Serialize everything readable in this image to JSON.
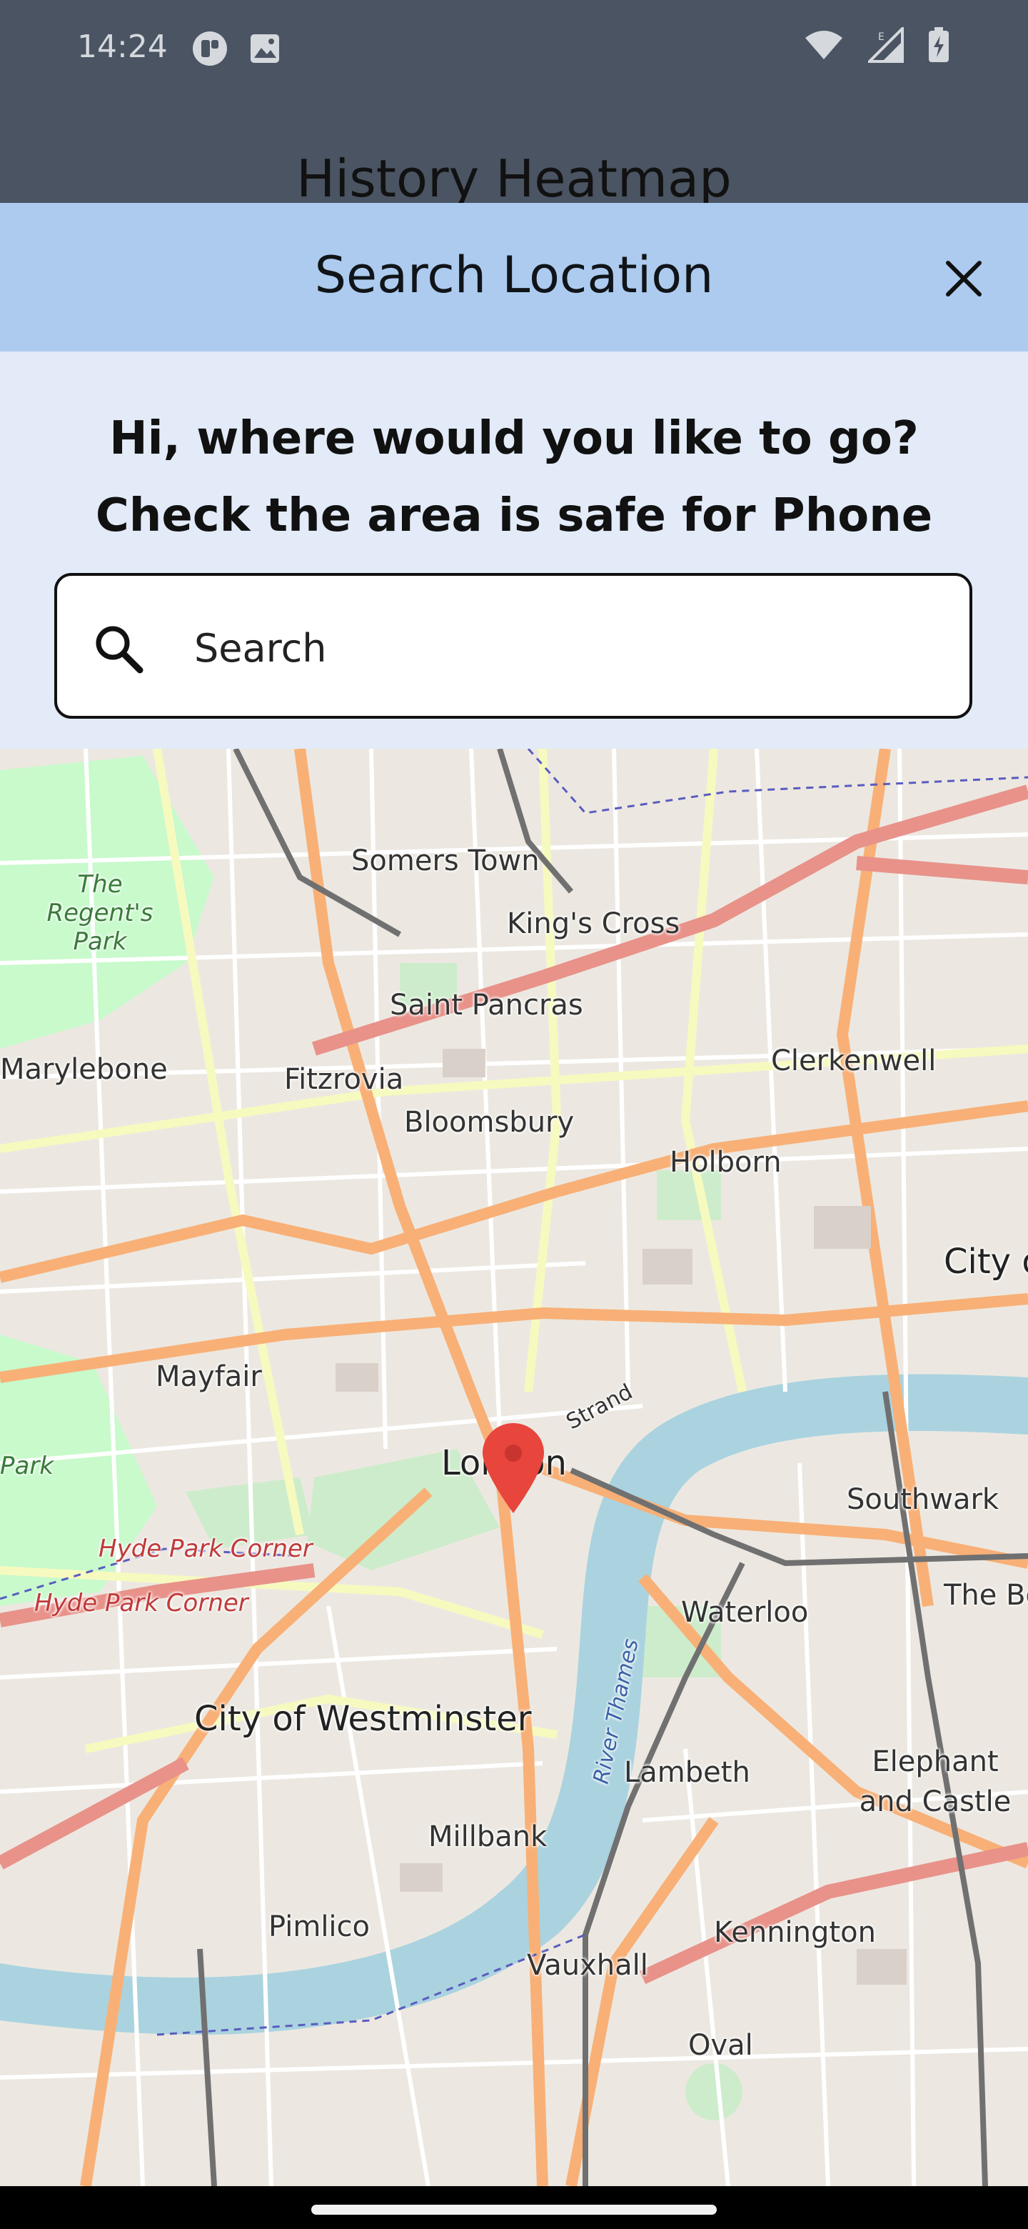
{
  "status_bar": {
    "time": "14:24",
    "left_icons": [
      "notification-app-icon",
      "image-icon"
    ],
    "right_icons": [
      "wifi-icon",
      "signal-icon",
      "battery-charging-icon"
    ]
  },
  "app_bar": {
    "title": "History Heatmap"
  },
  "sheet": {
    "title": "Search Location",
    "close_icon": "close-icon",
    "prompt_line1": "Hi, where would you like to go?",
    "prompt_line2": "Check the area is safe for Phone",
    "search": {
      "placeholder": "Search",
      "value": ""
    }
  },
  "map": {
    "labels": [
      "Somers Town",
      "King's Cross",
      "The Regent's Park",
      "Saint Pancras",
      "Marylebone",
      "Fitzrovia",
      "Clerkenwell",
      "Bloomsbury",
      "Holborn",
      "City of London",
      "Mayfair",
      "London",
      "Strand",
      "Southwark",
      "Hyde Park Corner",
      "Hyde Park Corner",
      "Waterloo",
      "The Borough",
      "City of Westminster",
      "River Thames",
      "Lambeth",
      "Elephant and Castle",
      "Millbank",
      "Pimlico",
      "Kennington",
      "Vauxhall",
      "Oval",
      "Park"
    ],
    "marker_icon": "location-pin-icon",
    "colors": {
      "water": "#aad3df",
      "park": "#c8facc",
      "major_road": "#f8b077",
      "motorway": "#e8928a"
    }
  }
}
